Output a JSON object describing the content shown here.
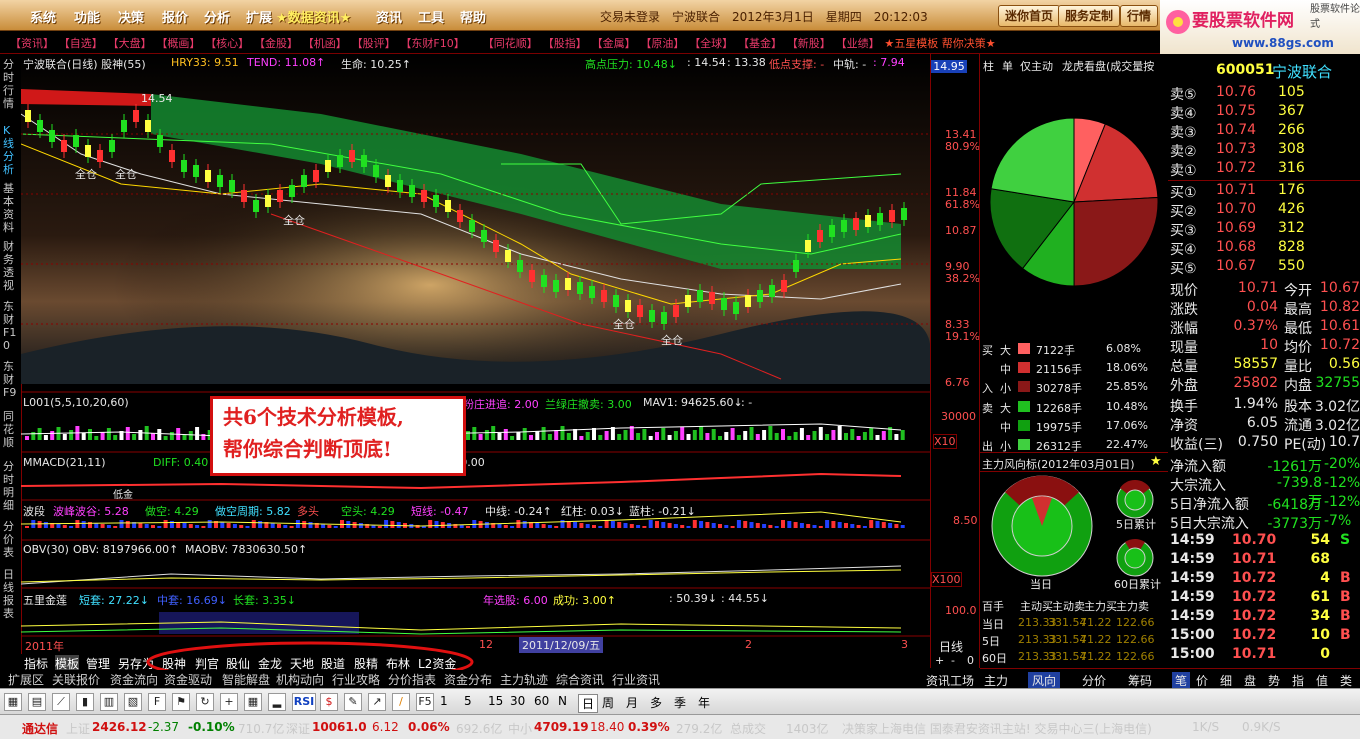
{
  "menubar": {
    "items": [
      "系统",
      "功能",
      "决策",
      "报价",
      "分析",
      "扩展",
      "★数据资讯★",
      "资讯",
      "工具",
      "帮助"
    ],
    "center": "交易未登录　宁波联合　2012年3月1日　星期四　20:12:03",
    "buttons": [
      "迷你首页",
      "服务定制",
      "行情"
    ]
  },
  "logo": {
    "text": "要股票软件网",
    "url": "www.88gs.com",
    "small": "股票软件论式"
  },
  "linkbar": [
    "【资讯】",
    "【自选】",
    "【大盘】",
    "【概画】",
    "【核心】",
    "【金股】",
    "【机函】",
    "【股评】",
    "【东财F10】",
    "【同花顺】",
    "【股指】",
    "【金属】",
    "【原油】",
    "【全球】",
    "【基金】",
    "【新股】",
    "【业绩】",
    "★五星模板 帮你决策★"
  ],
  "sidebar": [
    "分时行情",
    "K线分析",
    "基本资料",
    "财务透视",
    "东财F10",
    "东财F9",
    "同花顺",
    "分时明细",
    "分价表",
    "日线报表"
  ],
  "chart": {
    "title": "宁波联合(日线) 股神(55)",
    "hry": "HRY33: 9.51",
    "tend": "TEND: 11.08↑",
    "life": "生命: 10.25↑",
    "high_pressure": "高点压力: 10.48↓",
    "v1": ": 14.54",
    "v2": ": 13.38",
    "low_support": "低点支撑: -",
    "mid": "中轨: -",
    "mid_val": ": 7.94",
    "peak_label": "14.54",
    "price_box": "14.95",
    "prices": [
      "13.41",
      "11.84",
      "10.87",
      "9.90",
      "8.33",
      "6.76"
    ],
    "pcts": [
      "80.9%",
      "61.8%",
      "38.2%",
      "19.1%"
    ],
    "marks": [
      "全仓",
      "全仓",
      "全仓",
      "全仓",
      "全仓"
    ]
  },
  "ind1": {
    "title": "L001(5,5,10,20,60)",
    "a": "粉庄进追: 2.00",
    "b": "兰绿庄撤卖: 3.00",
    "c": "MAV1: 94625.60↓",
    "d": ": -",
    "scale": "30000",
    "xbox": "X10"
  },
  "ind2": {
    "title": "MMACD(21,11)",
    "diff": "DIFF: 0.40",
    "v": ": 0.00",
    "low": "低金"
  },
  "ind3": {
    "title": "波段",
    "a": "波峰波谷: 5.28",
    "b": "做空: 4.29",
    "c": "做空周期: 5.82",
    "d": "多头",
    "e": "空头: 4.29",
    "f": "短线: -0.47",
    "g": "中线: -0.24↑",
    "h": "红柱: 0.03↓",
    "i": "蓝柱: -0.21↓",
    "scale": "8.50"
  },
  "ind4": {
    "title": "OBV(30)",
    "a": "OBV: 8197966.00↑",
    "b": "MAOBV: 7830630.50↑",
    "xbox": "X100"
  },
  "ind5": {
    "title": "五里金莲",
    "a": "短套: 27.22↓",
    "b": "中套: 16.69↓",
    "c": "长套: 3.35↓",
    "d": "年选股: 6.00",
    "e": "成功: 3.00↑",
    "f": ": 50.39↓",
    "g": ": 44.55↓",
    "scale": "100.0"
  },
  "date_axis": {
    "a": "2011年",
    "b": "12",
    "c": "2011/12/09/五",
    "d": "2",
    "e": "3",
    "period": "日线"
  },
  "overlay": {
    "line1": "共6个技术分析模板,",
    "line2": "帮你综合判断顶底!"
  },
  "bottom1": [
    "指标",
    "模板",
    "管理",
    "另存为",
    "股神",
    "判官",
    "股仙",
    "金龙",
    "天地",
    "股道",
    "股精",
    "布林",
    "L2资金"
  ],
  "bottom2": [
    "扩展区",
    "关联报价",
    "资金流向",
    "资金驱动",
    "智能解盘",
    "机构动向",
    "行业攻略",
    "分价指表",
    "资金分布",
    "主力轨迹",
    "综合资讯",
    "行业资讯"
  ],
  "midpanel": {
    "tabs": [
      "柱",
      "单",
      "仅主动",
      "龙虎看盘(成交量按",
      "托"
    ],
    "buy_rows": [
      {
        "g": "买",
        "s": "大",
        "v": "7122手",
        "p": "6.08%"
      },
      {
        "g": "",
        "s": "中",
        "v": "21156手",
        "p": "18.06%"
      },
      {
        "g": "入",
        "s": "小",
        "v": "30278手",
        "p": "25.85%"
      }
    ],
    "sell_rows": [
      {
        "g": "卖",
        "s": "大",
        "v": "12268手",
        "p": "10.48%"
      },
      {
        "g": "",
        "s": "中",
        "v": "19975手",
        "p": "17.06%"
      },
      {
        "g": "出",
        "s": "小",
        "v": "26312手",
        "p": "22.47%"
      }
    ],
    "flow_title": "主力风向标(2012年03月01日)",
    "labels": [
      "当日",
      "5日累计",
      "60日累计"
    ],
    "table_head": [
      "百手",
      "主动买",
      "主动卖",
      "主力买",
      "主力卖"
    ],
    "table_rows": [
      {
        "k": "当日",
        "a": "213.33",
        "b": "331.54",
        "c": "71.22",
        "d": "122.66"
      },
      {
        "k": "5日",
        "a": "213.33",
        "b": "331.54",
        "c": "71.22",
        "d": "122.66"
      },
      {
        "k": "60日",
        "a": "213.33",
        "b": "331.54",
        "c": "71.22",
        "d": "122.66"
      }
    ],
    "bottom_tabs": [
      "资讯工场",
      "主力",
      "风向",
      "分价",
      "筹码"
    ]
  },
  "right": {
    "code": "600051",
    "name": "宁波联合",
    "sells": [
      {
        "l": "卖⑤",
        "p": "10.76",
        "v": "105"
      },
      {
        "l": "卖④",
        "p": "10.75",
        "v": "367"
      },
      {
        "l": "卖③",
        "p": "10.74",
        "v": "266"
      },
      {
        "l": "卖②",
        "p": "10.73",
        "v": "308"
      },
      {
        "l": "卖①",
        "p": "10.72",
        "v": "316"
      }
    ],
    "buys": [
      {
        "l": "买①",
        "p": "10.71",
        "v": "176"
      },
      {
        "l": "买②",
        "p": "10.70",
        "v": "426"
      },
      {
        "l": "买③",
        "p": "10.69",
        "v": "312"
      },
      {
        "l": "买④",
        "p": "10.68",
        "v": "828"
      },
      {
        "l": "买⑤",
        "p": "10.67",
        "v": "550"
      }
    ],
    "stats": [
      {
        "a": "现价",
        "b": "10.71",
        "c": "今开",
        "d": "10.67"
      },
      {
        "a": "涨跌",
        "b": "0.04",
        "c": "最高",
        "d": "10.82"
      },
      {
        "a": "涨幅",
        "b": "0.37%",
        "c": "最低",
        "d": "10.61"
      },
      {
        "a": "现量",
        "b": "10",
        "c": "均价",
        "d": "10.72"
      },
      {
        "a": "总量",
        "b": "58557",
        "c": "量比",
        "d": "0.56"
      },
      {
        "a": "外盘",
        "b": "25802",
        "c": "内盘",
        "d": "32755"
      }
    ],
    "stats2": [
      {
        "a": "换手",
        "b": "1.94%",
        "c": "股本",
        "d": "3.02亿"
      },
      {
        "a": "净资",
        "b": "6.05",
        "c": "流通",
        "d": "3.02亿"
      },
      {
        "a": "收益(三)",
        "b": "0.750",
        "c": "PE(动)",
        "d": "10.7"
      }
    ],
    "flows": [
      {
        "a": "净流入额",
        "b": "-1261万",
        "c": "-20%"
      },
      {
        "a": "大宗流入",
        "b": "-739.8万",
        "c": "-12%"
      },
      {
        "a": "5日净流入额",
        "b": "-6418万",
        "c": "-12%"
      },
      {
        "a": "5日大宗流入",
        "b": "-3773万",
        "c": "-7%"
      }
    ],
    "ticks": [
      {
        "t": "14:59",
        "p": "10.70",
        "v": "54",
        "d": "S"
      },
      {
        "t": "14:59",
        "p": "10.71",
        "v": "68",
        "d": ""
      },
      {
        "t": "14:59",
        "p": "10.72",
        "v": "4",
        "d": "B"
      },
      {
        "t": "14:59",
        "p": "10.72",
        "v": "61",
        "d": "B"
      },
      {
        "t": "14:59",
        "p": "10.72",
        "v": "34",
        "d": "B"
      },
      {
        "t": "15:00",
        "p": "10.72",
        "v": "10",
        "d": "B"
      },
      {
        "t": "15:00",
        "p": "10.71",
        "v": "0",
        "d": ""
      }
    ],
    "bottom_tabs": [
      "笔",
      "价",
      "细",
      "盘",
      "势",
      "指",
      "值",
      "类"
    ]
  },
  "toolbar": {
    "periods": [
      "F5",
      "1",
      "5",
      "15",
      "30",
      "60",
      "N",
      "日",
      "周",
      "月",
      "多",
      "季",
      "年"
    ],
    "rsi": "RSI"
  },
  "status": {
    "brand": "通达信",
    "sh": "上证",
    "sh_val": "2426.12",
    "sh_chg": "-2.37",
    "sh_pct": "-0.10%",
    "sh_amt": "710.7亿",
    "sz": "深证",
    "sz_val": "10061.0",
    "sz_chg": "6.12",
    "sz_pct": "0.06%",
    "sz_amt": "692.6亿",
    "zx": "中小",
    "zx_val": "4709.19",
    "zx_chg": "18.40",
    "zx_pct": "0.39%",
    "zx_amt": "279.2亿",
    "total": "总成交",
    "total_val": "1403亿",
    "news": "决策家上海电信 国泰君安资讯主站! 交易中心三(上海电信)",
    "speed1": "1K/S",
    "speed2": "0.9K/S"
  }
}
